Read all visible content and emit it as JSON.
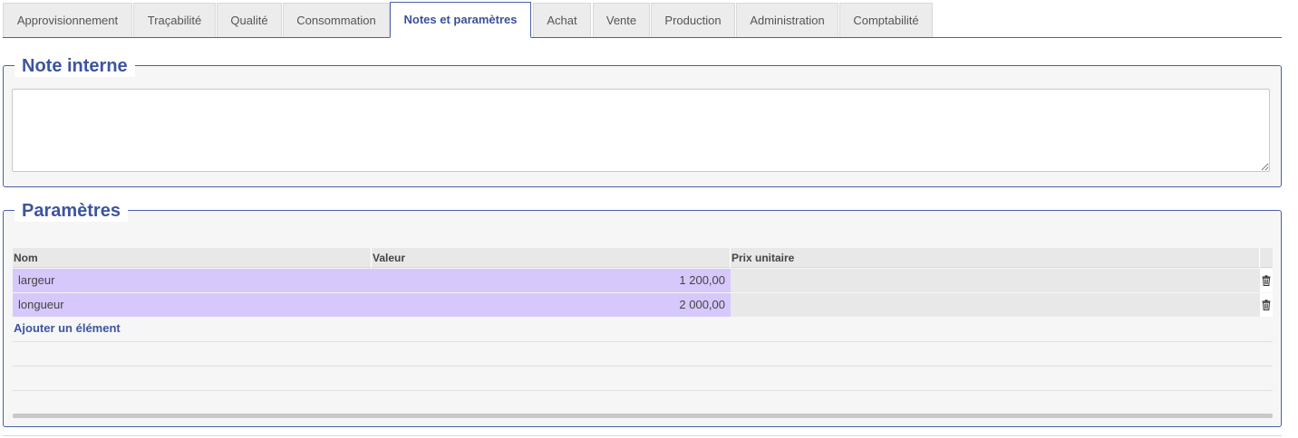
{
  "tabs": [
    {
      "label": "Approvisionnement",
      "active": false
    },
    {
      "label": "Traçabilité",
      "active": false
    },
    {
      "label": "Qualité",
      "active": false
    },
    {
      "label": "Consommation",
      "active": false
    },
    {
      "label": "Notes et paramètres",
      "active": true
    },
    {
      "label": "Achat",
      "active": false
    },
    {
      "label": "Vente",
      "active": false
    },
    {
      "label": "Production",
      "active": false
    },
    {
      "label": "Administration",
      "active": false
    },
    {
      "label": "Comptabilité",
      "active": false
    }
  ],
  "note": {
    "legend": "Note interne",
    "value": ""
  },
  "params": {
    "legend": "Paramètres",
    "columns": {
      "name": "Nom",
      "value": "Valeur",
      "unit_price": "Prix unitaire"
    },
    "rows": [
      {
        "name": "largeur",
        "value": "1 200,00",
        "unit_price": ""
      },
      {
        "name": "longueur",
        "value": "2 000,00",
        "unit_price": ""
      }
    ],
    "add_label": "Ajouter un élément",
    "delete_icon": "trash-icon"
  },
  "colors": {
    "accent": "#3d55a0",
    "row_highlight": "#d7c8fc",
    "border": "#4b5fa6"
  }
}
